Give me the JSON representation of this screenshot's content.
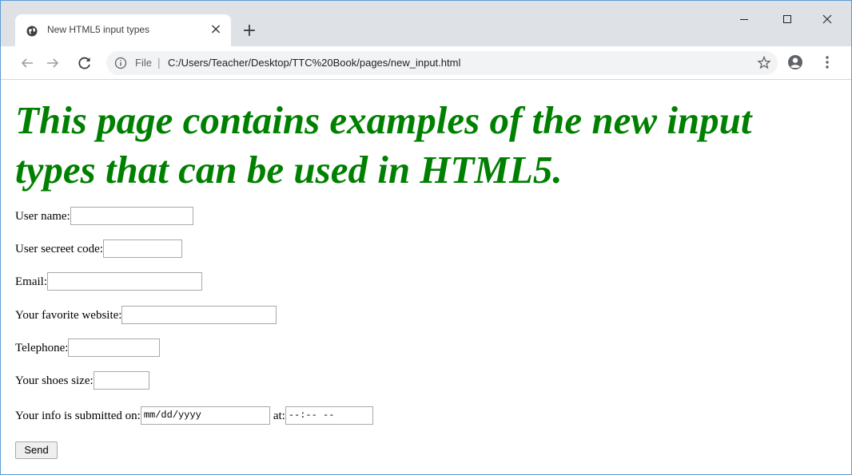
{
  "browser": {
    "tab_title": "New HTML5 input types",
    "tab_close": "×",
    "new_tab": "+",
    "address_scheme": "File",
    "address_separator": "|",
    "address_url": "C:/Users/Teacher/Desktop/TTC%20Book/pages/new_input.html",
    "icons": {
      "back": "back-arrow-icon",
      "forward": "forward-arrow-icon",
      "reload": "reload-icon",
      "info": "info-icon",
      "bookmark": "star-icon",
      "profile": "account-icon",
      "menu": "kebab-menu-icon",
      "minimize": "minimize-icon",
      "maximize": "maximize-icon",
      "close": "close-icon"
    },
    "accent": "#5b9bd5"
  },
  "page": {
    "heading": "This page contains examples of the new input types that can be used in HTML5.",
    "heading_color": "#008000",
    "form": {
      "username_label": "User name:",
      "username_value": "",
      "secret_label": "User secreet code:",
      "secret_value": "",
      "email_label": "Email:",
      "email_value": "",
      "website_label": "Your favorite website:",
      "website_value": "",
      "telephone_label": "Telephone:",
      "telephone_value": "",
      "shoe_label": "Your shoes size:",
      "shoe_value": "",
      "submitted_label": "Your info is submitted on:",
      "date_placeholder": "mm/dd/yyyy",
      "at_label": "at:",
      "time_placeholder": "--:-- --",
      "send_label": "Send"
    }
  }
}
